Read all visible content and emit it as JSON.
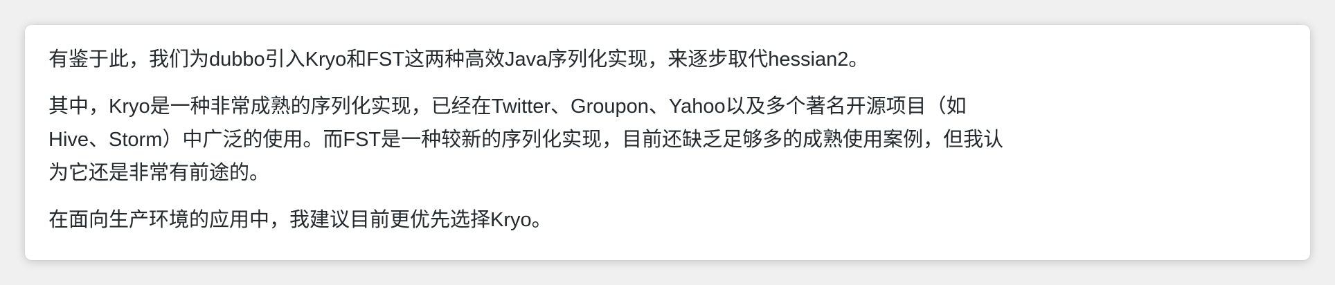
{
  "paragraphs": [
    {
      "lines": [
        "有鉴于此，我们为dubbo引入Kryo和FST这两种高效Java序列化实现，来逐步取代hessian2。"
      ]
    },
    {
      "lines": [
        "其中，Kryo是一种非常成熟的序列化实现，已经在Twitter、Groupon、Yahoo以及多个著名开源项目（如",
        "Hive、Storm）中广泛的使用。而FST是一种较新的序列化实现，目前还缺乏足够多的成熟使用案例，但我认",
        "为它还是非常有前途的。"
      ]
    },
    {
      "lines": [
        "在面向生产环境的应用中，我建议目前更优先选择Kryo。"
      ]
    }
  ],
  "colors": {
    "text": "#24292e",
    "card_background": "#ffffff",
    "page_background": "#f0f0f0"
  }
}
